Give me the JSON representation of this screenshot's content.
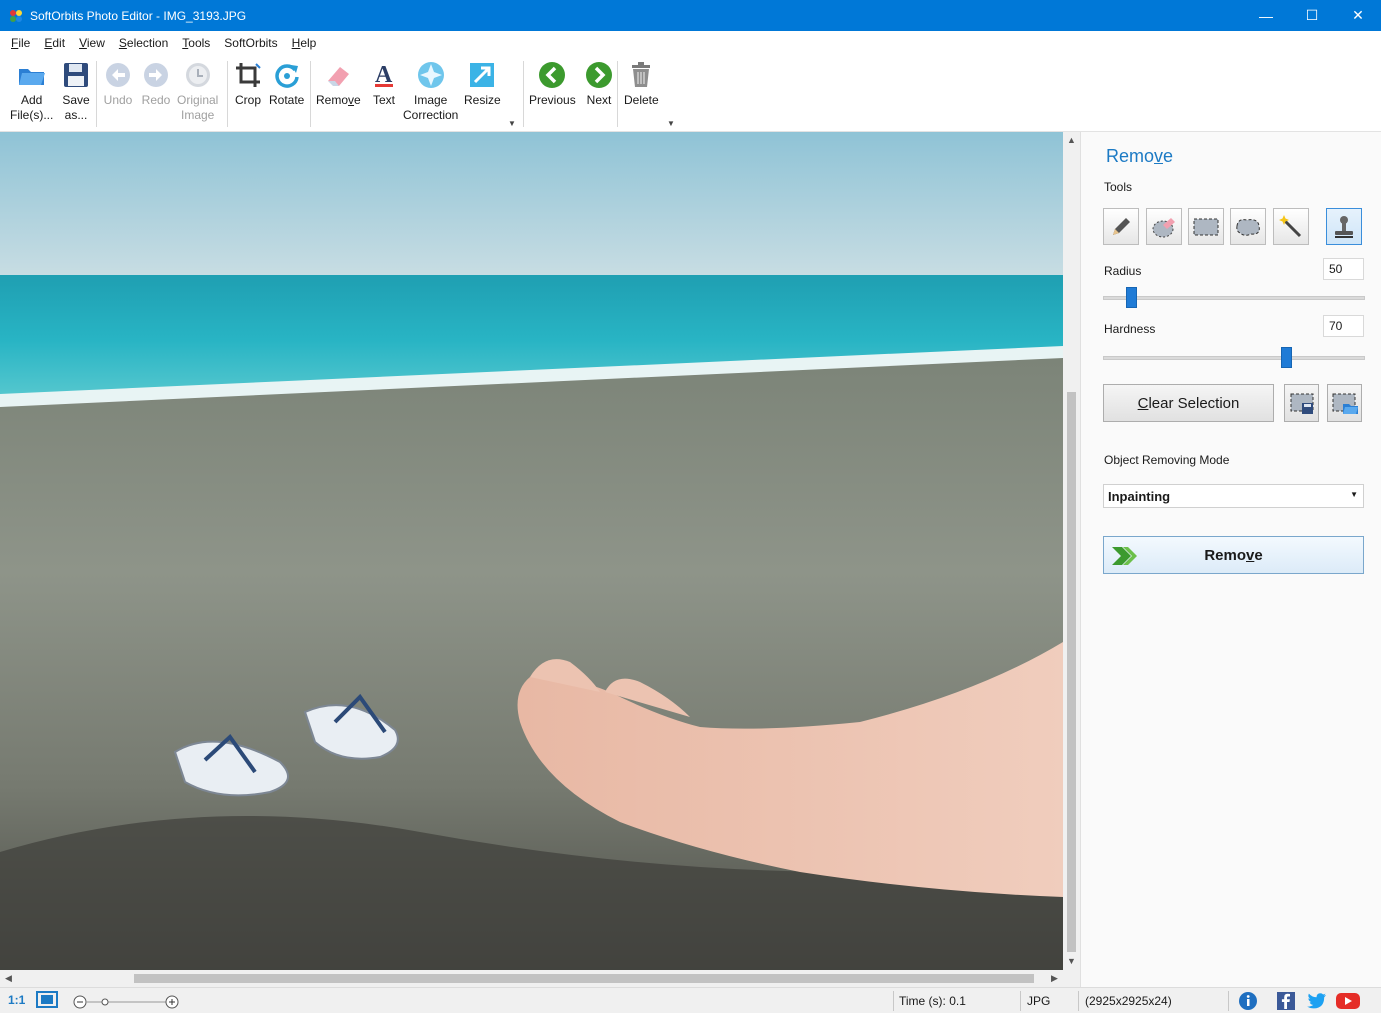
{
  "window": {
    "title": "SoftOrbits Photo Editor - IMG_3193.JPG",
    "minimize": "—",
    "maximize": "☐",
    "close": "✕"
  },
  "menu": {
    "items": [
      {
        "acc": "F",
        "rest": "ile"
      },
      {
        "acc": "E",
        "rest": "dit"
      },
      {
        "acc": "V",
        "rest": "iew"
      },
      {
        "acc": "S",
        "rest": "election"
      },
      {
        "acc": "T",
        "rest": "ools"
      },
      {
        "acc": "",
        "rest": "SoftOrbits"
      },
      {
        "acc": "H",
        "rest": "elp"
      }
    ]
  },
  "toolbar": {
    "add_files": "Add\nFile(s)...",
    "save_as": "Save\nas...",
    "undo": "Undo",
    "redo": "Redo",
    "original_image": "Original\nImage",
    "crop": "Crop",
    "rotate": "Rotate",
    "remove": "Remove",
    "text": "Text",
    "image_correction": "Image\nCorrection",
    "resize": "Resize",
    "previous": "Previous",
    "next": "Next",
    "delete": "Delete"
  },
  "panel": {
    "title_pre": "Remo",
    "title_acc": "v",
    "title_post": "e",
    "tools_label": "Tools",
    "radius_label": "Radius",
    "radius_value": "50",
    "radius_fraction": 0.11,
    "hardness_label": "Hardness",
    "hardness_value": "70",
    "hardness_fraction": 0.7,
    "clear_acc": "C",
    "clear_rest": "lear Selection",
    "mode_label": "Object Removing Mode",
    "mode_value": "Inpainting",
    "remove_pre": "Remo",
    "remove_acc": "v",
    "remove_post": "e"
  },
  "status": {
    "zoom_label": "1:1",
    "time": "Time (s): 0.1",
    "format": "JPG",
    "dimensions": "(2925x2925x24)"
  },
  "colors": {
    "titlebar": "#0078d7",
    "accent": "#1c7ac4",
    "slider": "#1f7bd6"
  }
}
